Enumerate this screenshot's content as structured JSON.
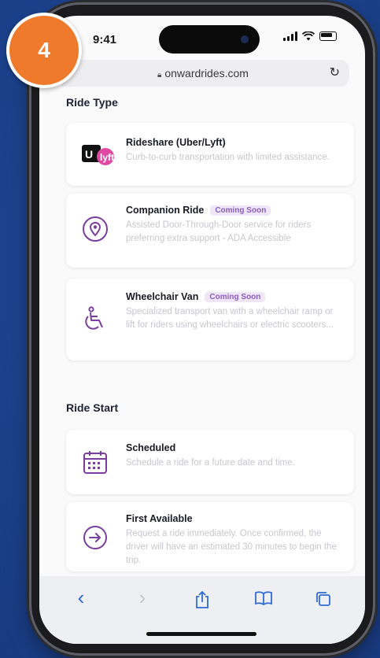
{
  "step": "4",
  "status_bar": {
    "time": "9:41"
  },
  "browser": {
    "url": "onwardrides.com"
  },
  "ride_type": {
    "title": "Ride Type",
    "options": [
      {
        "title": "Rideshare (Uber/Lyft)",
        "desc": "Curb-to-curb transportation with limited assistance.",
        "badge": ""
      },
      {
        "title": "Companion Ride",
        "desc": "Assisted Door-Through-Door service for riders preferring extra support - ADA Accessible",
        "badge": "Coming Soon"
      },
      {
        "title": "Wheelchair Van",
        "desc": "Specialized transport van with a wheelchair ramp or lift for riders using wheelchairs or electric scooters...",
        "badge": "Coming Soon"
      }
    ]
  },
  "ride_start": {
    "title": "Ride Start",
    "options": [
      {
        "title": "Scheduled",
        "desc": "Schedule a ride for a future date and time."
      },
      {
        "title": "First Available",
        "desc": "Request a ride immediately. Once confirmed, the driver will have an estimated 30 minutes to begin the trip."
      }
    ]
  },
  "toolbar": {
    "back": "‹",
    "share_icon": "share-icon",
    "bookmarks_icon": "book-icon",
    "tabs_icon": "tabs-icon"
  },
  "colors": {
    "accent": "#7a3e9e",
    "brand_badge": "#ef7a2b",
    "toolbar_blue": "#2e6bd6"
  }
}
